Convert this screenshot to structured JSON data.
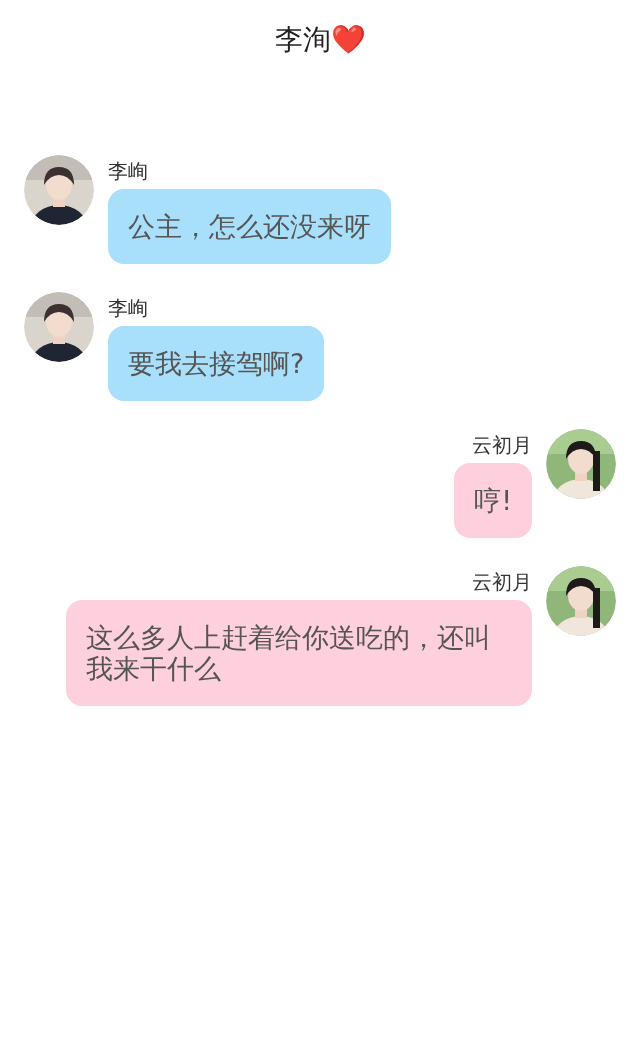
{
  "title": "李洵❤️",
  "messages": [
    {
      "kind": "incoming",
      "sender": "李峋",
      "text": "公主，怎么还没来呀"
    },
    {
      "kind": "incoming",
      "sender": "李峋",
      "text": "要我去接驾啊?"
    },
    {
      "kind": "outgoing",
      "sender": "云初月",
      "text": "哼!"
    },
    {
      "kind": "outgoing",
      "sender": "云初月",
      "text": "这么多人上赶着给你送吃的，还叫我来干什么"
    }
  ]
}
